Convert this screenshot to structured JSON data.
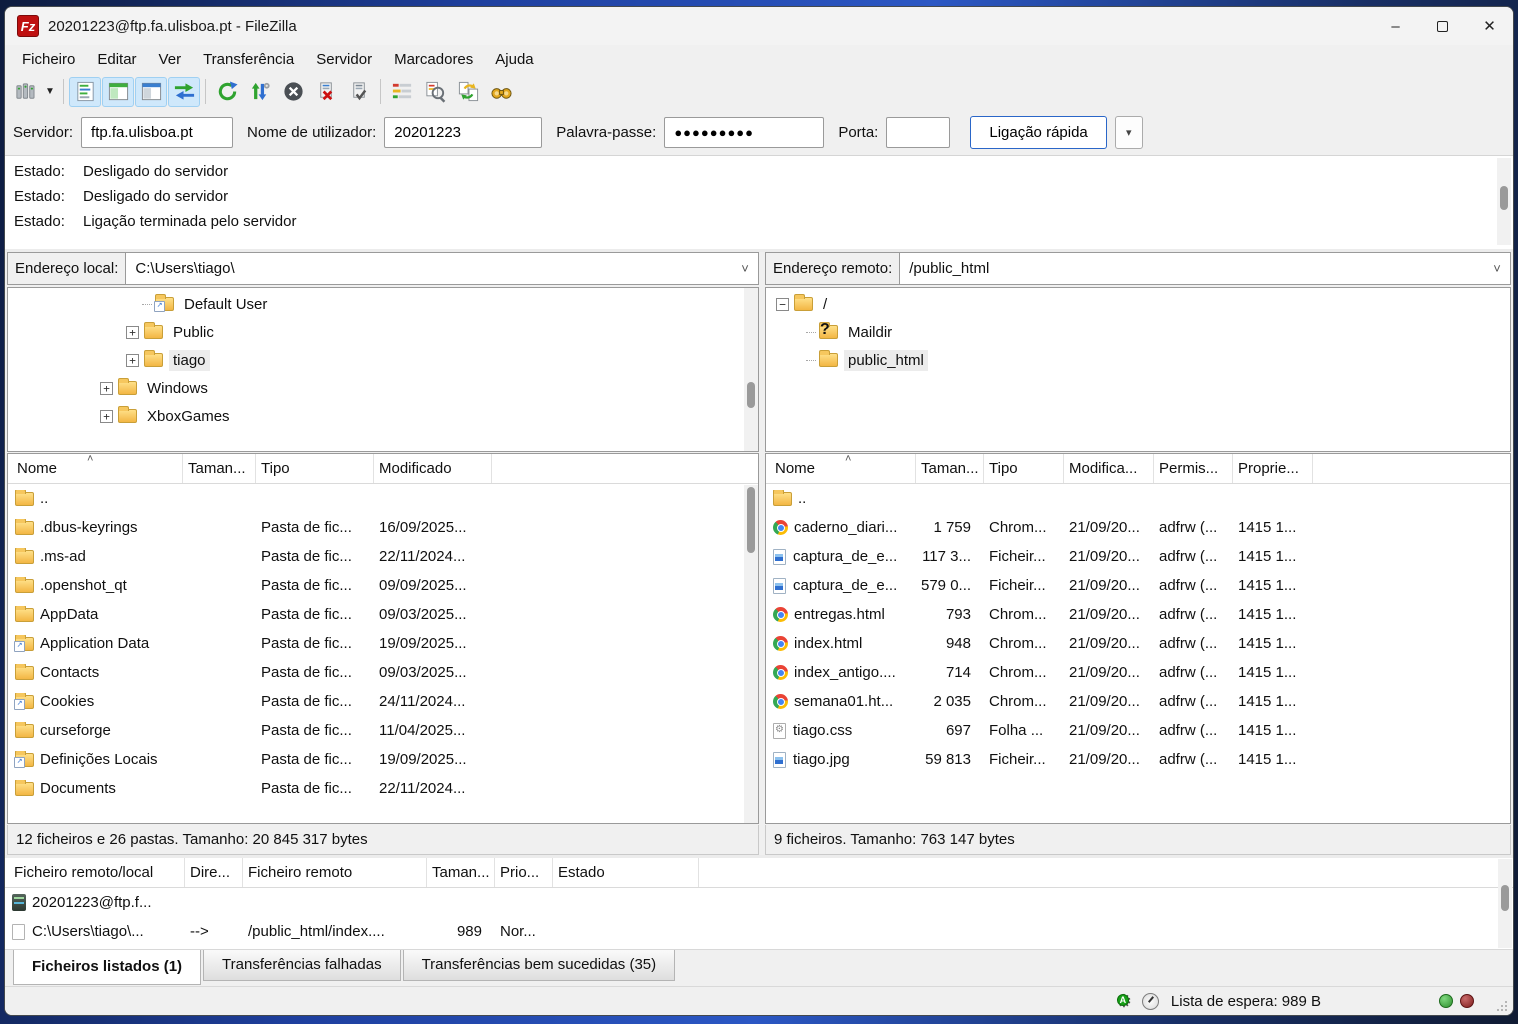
{
  "window": {
    "title": "20201223@ftp.fa.ulisboa.pt - FileZilla",
    "logo_text": "Fz"
  },
  "menu": {
    "items": [
      "Ficheiro",
      "Editar",
      "Ver",
      "Transferência",
      "Servidor",
      "Marcadores",
      "Ajuda"
    ]
  },
  "toolbar": {
    "buttons": [
      "site-manager",
      "site-manager-dropdown",
      "toggle-message-log",
      "toggle-local-tree",
      "toggle-remote-tree",
      "toggle-transfer-queue",
      "refresh",
      "process-queue",
      "cancel-operation",
      "disconnect",
      "reconnect",
      "directory-listing-filters",
      "directory-comparison",
      "synchronized-browsing",
      "find-files"
    ]
  },
  "icons": {
    "chevron_down": "˅",
    "dropdown_arrow": "▾",
    "sort_asc": "˄",
    "minimize": "–",
    "close": "✕",
    "gear": "⚙"
  },
  "colors": {
    "accent_blue": "#2a66c8",
    "folder_yellow": "#f3b644",
    "active_toggle": "#cfe8fb",
    "logo_red": "#bf1010",
    "light_green": "#2e8f2e",
    "light_red": "#7e1d1d"
  },
  "quickconnect": {
    "server_label": "Servidor:",
    "server_value": "ftp.fa.ulisboa.pt",
    "user_label": "Nome de utilizador:",
    "user_value": "20201223",
    "password_label": "Palavra-passe:",
    "password_value": "●●●●●●●●●",
    "port_label": "Porta:",
    "port_value": "",
    "connect_button": "Ligação rápida"
  },
  "log": {
    "entries": [
      {
        "label": "Estado:",
        "message": "Desligado do servidor"
      },
      {
        "label": "Estado:",
        "message": "Desligado do servidor"
      },
      {
        "label": "Estado:",
        "message": "Ligação terminada pelo servidor"
      }
    ]
  },
  "local_pane": {
    "address_label": "Endereço local:",
    "address_value": "C:\\Users\\tiago\\",
    "tree": [
      {
        "name": "Default User",
        "expander": ""
      },
      {
        "name": "Public",
        "expander": "+"
      },
      {
        "name": "tiago",
        "expander": "+"
      },
      {
        "name": "Windows",
        "expander": "+"
      },
      {
        "name": "XboxGames",
        "expander": "+"
      }
    ],
    "columns": [
      "Nome",
      "Taman...",
      "Tipo",
      "Modificado"
    ],
    "files": [
      {
        "name": "..",
        "size": "",
        "type": "",
        "modified": ""
      },
      {
        "name": ".dbus-keyrings",
        "size": "",
        "type": "Pasta de fic...",
        "modified": "16/09/2025..."
      },
      {
        "name": ".ms-ad",
        "size": "",
        "type": "Pasta de fic...",
        "modified": "22/11/2024..."
      },
      {
        "name": ".openshot_qt",
        "size": "",
        "type": "Pasta de fic...",
        "modified": "09/09/2025..."
      },
      {
        "name": "AppData",
        "size": "",
        "type": "Pasta de fic...",
        "modified": "09/03/2025..."
      },
      {
        "name": "Application Data",
        "size": "",
        "type": "Pasta de fic...",
        "modified": "19/09/2025..."
      },
      {
        "name": "Contacts",
        "size": "",
        "type": "Pasta de fic...",
        "modified": "09/03/2025..."
      },
      {
        "name": "Cookies",
        "size": "",
        "type": "Pasta de fic...",
        "modified": "24/11/2024..."
      },
      {
        "name": "curseforge",
        "size": "",
        "type": "Pasta de fic...",
        "modified": "11/04/2025..."
      },
      {
        "name": "Definições Locais",
        "size": "",
        "type": "Pasta de fic...",
        "modified": "19/09/2025..."
      },
      {
        "name": "Documents",
        "size": "",
        "type": "Pasta de fic...",
        "modified": "22/11/2024..."
      }
    ],
    "status": "12 ficheiros e 26 pastas. Tamanho: 20 845 317 bytes"
  },
  "remote_pane": {
    "address_label": "Endereço remoto:",
    "address_value": "/public_html",
    "tree": [
      {
        "name": "/",
        "expander": "−"
      },
      {
        "name": "Maildir",
        "expander": ""
      },
      {
        "name": "public_html",
        "expander": ""
      }
    ],
    "columns": [
      "Nome",
      "Taman...",
      "Tipo",
      "Modifica...",
      "Permis...",
      "Proprie..."
    ],
    "files": [
      {
        "name": "..",
        "size": "",
        "type": "",
        "modified": "",
        "perms": "",
        "owner": ""
      },
      {
        "name": "caderno_diari...",
        "size": "1 759",
        "type": "Chrom...",
        "modified": "21/09/20...",
        "perms": "adfrw (...",
        "owner": "1415 1..."
      },
      {
        "name": "captura_de_e...",
        "size": "117 3...",
        "type": "Ficheir...",
        "modified": "21/09/20...",
        "perms": "adfrw (...",
        "owner": "1415 1..."
      },
      {
        "name": "captura_de_e...",
        "size": "579 0...",
        "type": "Ficheir...",
        "modified": "21/09/20...",
        "perms": "adfrw (...",
        "owner": "1415 1..."
      },
      {
        "name": "entregas.html",
        "size": "793",
        "type": "Chrom...",
        "modified": "21/09/20...",
        "perms": "adfrw (...",
        "owner": "1415 1..."
      },
      {
        "name": "index.html",
        "size": "948",
        "type": "Chrom...",
        "modified": "21/09/20...",
        "perms": "adfrw (...",
        "owner": "1415 1..."
      },
      {
        "name": "index_antigo....",
        "size": "714",
        "type": "Chrom...",
        "modified": "21/09/20...",
        "perms": "adfrw (...",
        "owner": "1415 1..."
      },
      {
        "name": "semana01.ht...",
        "size": "2 035",
        "type": "Chrom...",
        "modified": "21/09/20...",
        "perms": "adfrw (...",
        "owner": "1415 1..."
      },
      {
        "name": "tiago.css",
        "size": "697",
        "type": "Folha ...",
        "modified": "21/09/20...",
        "perms": "adfrw (...",
        "owner": "1415 1..."
      },
      {
        "name": "tiago.jpg",
        "size": "59 813",
        "type": "Ficheir...",
        "modified": "21/09/20...",
        "perms": "adfrw (...",
        "owner": "1415 1..."
      }
    ],
    "status": "9 ficheiros. Tamanho: 763 147 bytes"
  },
  "queue": {
    "columns": [
      "Ficheiro remoto/local",
      "Dire...",
      "Ficheiro remoto",
      "Taman...",
      "Prio...",
      "Estado"
    ],
    "rows": [
      {
        "name": "20201223@ftp.f...",
        "direction": "",
        "remote": "",
        "size": "",
        "priority": "",
        "status": ""
      },
      {
        "name": "C:\\Users\\tiago\\...",
        "direction": "-->",
        "remote": "/public_html/index....",
        "size": "989",
        "priority": "Nor...",
        "status": ""
      }
    ],
    "tabs": [
      {
        "label": "Ficheiros listados (1)"
      },
      {
        "label": "Transferências falhadas"
      },
      {
        "label": "Transferências bem sucedidas (35)"
      }
    ]
  },
  "statusbar": {
    "gear_badge": "A",
    "queue_label": "Lista de espera: 989 B"
  }
}
